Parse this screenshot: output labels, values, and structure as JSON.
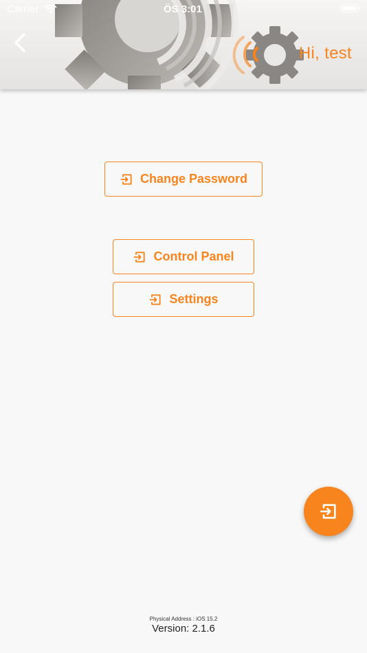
{
  "status_bar": {
    "carrier": "Carrier",
    "time": "ÖS 3:01"
  },
  "header": {
    "greeting": "Hi, test"
  },
  "buttons": {
    "change_password": "Change Password",
    "control_panel": "Control Panel",
    "settings": "Settings"
  },
  "footer": {
    "physical_address": "Physical Address : iOS 15.2",
    "version": "Version: 2.1.6"
  },
  "colors": {
    "accent": "#f7841d",
    "background": "#f8f8f8"
  },
  "icons": {
    "back": "chevron-left-icon",
    "button": "login-icon",
    "fab": "login-icon"
  }
}
